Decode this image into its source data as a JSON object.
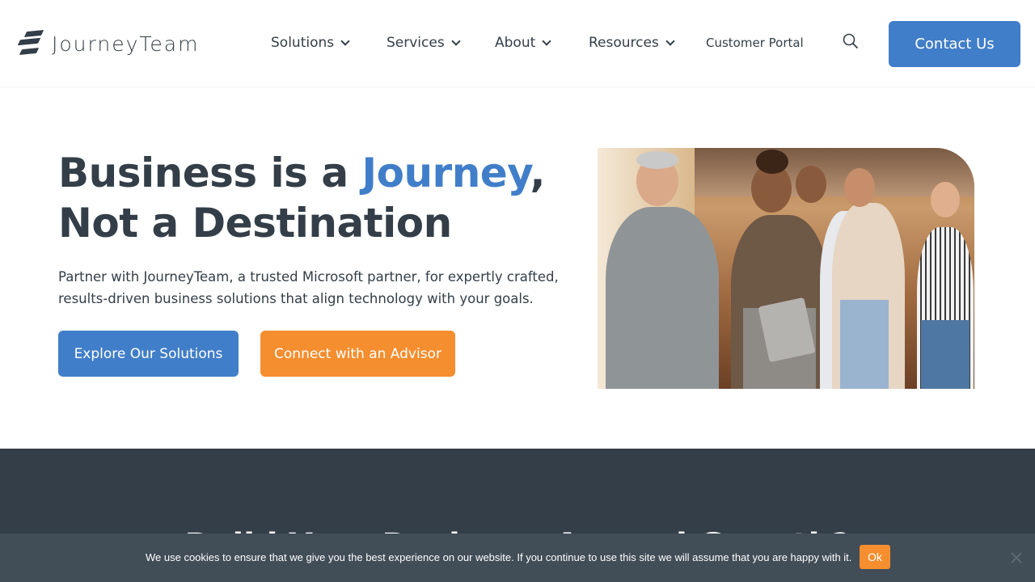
{
  "header": {
    "logo_text": "JourneyTeam",
    "nav": [
      {
        "label": "Solutions",
        "has_dropdown": true
      },
      {
        "label": "Services",
        "has_dropdown": true
      },
      {
        "label": "About",
        "has_dropdown": true
      },
      {
        "label": "Resources",
        "has_dropdown": true
      }
    ],
    "portal_label": "Customer Portal",
    "search_icon": "search-icon",
    "contact_label": "Contact Us"
  },
  "hero": {
    "title_part1": "Business is a ",
    "title_accent": "Journey",
    "title_part2": ",",
    "title_line2": "Not a Destination",
    "subtitle": "Partner with JourneyTeam, a trusted Microsoft partner, for expertly crafted, results-driven business solutions that align technology with your goals.",
    "primary_button": "Explore Our Solutions",
    "secondary_button": "Connect with an Advisor",
    "image_alt": "Team of colleagues walking and talking in a modern office"
  },
  "next_section": {
    "heading": "Build Your Business Around Growth?"
  },
  "cookie_bar": {
    "message": "We use cookies to ensure that we give you the best experience on our website. If you continue to use this site we will assume that you are happy with it.",
    "ok_label": "Ok",
    "close_icon": "close-icon"
  },
  "colors": {
    "brand_blue": "#417ec9",
    "brand_orange": "#f58e2f",
    "dark_slate": "#333e48",
    "cookie_bg": "#414d57"
  }
}
